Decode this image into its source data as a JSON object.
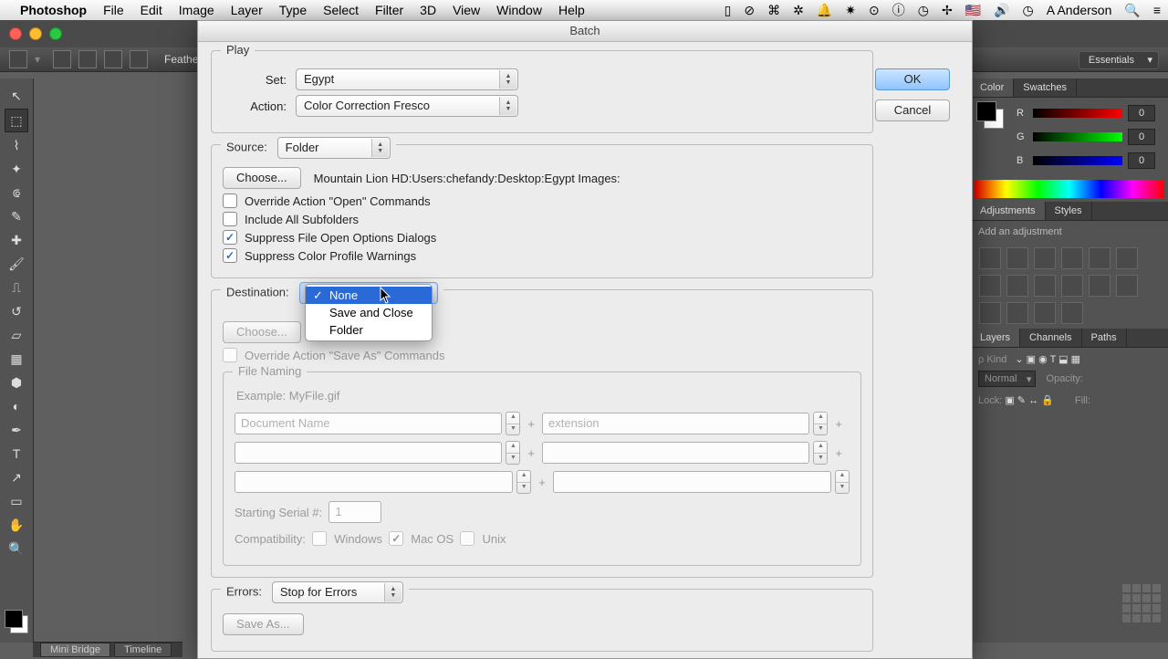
{
  "menubar": {
    "app": "Photoshop",
    "items": [
      "File",
      "Edit",
      "Image",
      "Layer",
      "Type",
      "Select",
      "Filter",
      "3D",
      "View",
      "Window",
      "Help"
    ],
    "user": "A Anderson"
  },
  "optionsbar": {
    "feather_label": "Feather"
  },
  "workspace": "Essentials",
  "footer": {
    "tabs": [
      "Mini Bridge",
      "Timeline"
    ]
  },
  "panels": {
    "color_tabs": [
      "Color",
      "Swatches"
    ],
    "rgb": {
      "r": "0",
      "g": "0",
      "b": "0"
    },
    "adjustments_tabs": [
      "Adjustments",
      "Styles"
    ],
    "add_adjustment": "Add an adjustment",
    "layer_tabs": [
      "Layers",
      "Channels",
      "Paths"
    ],
    "blend": "Normal",
    "opacity_label": "Opacity:",
    "lock_label": "Lock:",
    "fill_label": "Fill:"
  },
  "dialog": {
    "title": "Batch",
    "ok": "OK",
    "cancel": "Cancel",
    "play": {
      "legend": "Play",
      "set_label": "Set:",
      "set_value": "Egypt",
      "action_label": "Action:",
      "action_value": "Color Correction Fresco"
    },
    "source": {
      "label": "Source:",
      "value": "Folder",
      "choose": "Choose...",
      "path": "Mountain Lion HD:Users:chefandy:Desktop:Egypt Images:",
      "override_open": "Override Action \"Open\" Commands",
      "include_sub": "Include All Subfolders",
      "suppress_open": "Suppress File Open Options Dialogs",
      "suppress_color": "Suppress Color Profile Warnings"
    },
    "destination": {
      "label": "Destination:",
      "choose": "Choose...",
      "override_save": "Override Action \"Save As\" Commands",
      "options": [
        "None",
        "Save and Close",
        "Folder"
      ]
    },
    "naming": {
      "legend": "File Naming",
      "example": "Example: MyFile.gif",
      "field1": "Document Name",
      "field2": "extension",
      "serial_label": "Starting Serial #:",
      "serial_value": "1",
      "compat_label": "Compatibility:",
      "compat_win": "Windows",
      "compat_mac": "Mac OS",
      "compat_unix": "Unix"
    },
    "errors": {
      "label": "Errors:",
      "value": "Stop for Errors",
      "save_as": "Save As..."
    }
  }
}
